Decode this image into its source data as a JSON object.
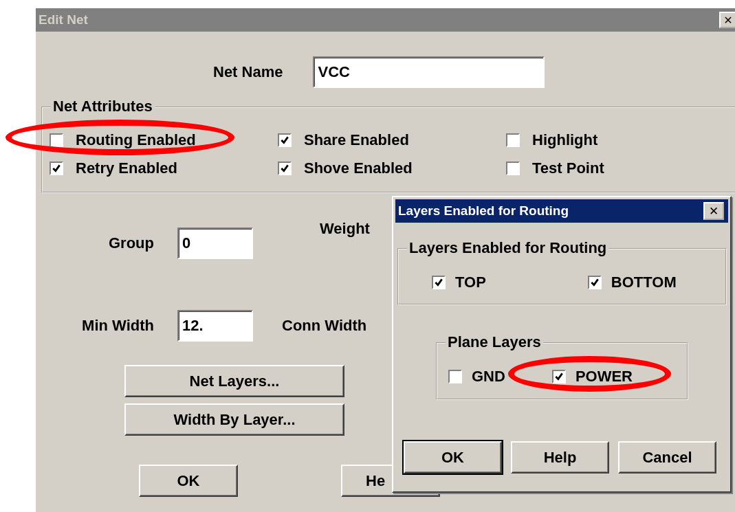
{
  "window": {
    "title": "Edit Net",
    "close": "✕"
  },
  "net_name": {
    "label": "Net Name",
    "value": "VCC"
  },
  "net_attributes": {
    "title": "Net Attributes",
    "items": [
      {
        "label": "Routing Enabled",
        "checked": false,
        "circled": true
      },
      {
        "label": "Share Enabled",
        "checked": true,
        "circled": false
      },
      {
        "label": "Highlight",
        "checked": false,
        "circled": false
      },
      {
        "label": "Retry Enabled",
        "checked": true,
        "circled": false
      },
      {
        "label": "Shove Enabled",
        "checked": true,
        "circled": false
      },
      {
        "label": "Test Point",
        "checked": false,
        "circled": false
      }
    ]
  },
  "fields": [
    {
      "label": "Group",
      "value": "0",
      "side_label": "Weight"
    },
    {
      "label": "Min Width",
      "value": "12.",
      "side_label": "Conn Width"
    }
  ],
  "buttons": [
    "Net Layers...",
    "Width By Layer..."
  ],
  "footer_buttons": [
    {
      "label": "OK",
      "default": false
    },
    {
      "label": "He",
      "default": false
    }
  ],
  "layers_dialog": {
    "title": "Layers Enabled for Routing",
    "close": "✕",
    "routing_group": {
      "title": "Layers Enabled for Routing",
      "items": [
        {
          "label": "TOP",
          "checked": true,
          "circled": false
        },
        {
          "label": "BOTTOM",
          "checked": true,
          "circled": false
        }
      ]
    },
    "plane_group": {
      "title": "Plane Layers",
      "items": [
        {
          "label": "GND",
          "checked": false,
          "circled": false
        },
        {
          "label": "POWER",
          "checked": true,
          "circled": true
        }
      ]
    },
    "buttons": [
      {
        "label": "OK",
        "default": true
      },
      {
        "label": "Help",
        "default": false
      },
      {
        "label": "Cancel",
        "default": false
      }
    ]
  }
}
